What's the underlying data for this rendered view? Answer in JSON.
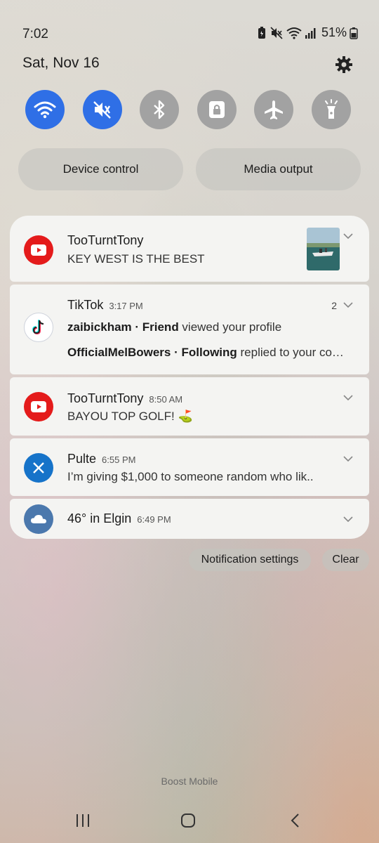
{
  "status_bar": {
    "time": "7:02",
    "battery_percent": "51%"
  },
  "header": {
    "date": "Sat, Nov 16"
  },
  "quick_toggles": [
    {
      "name": "wifi",
      "icon": "wifi-icon",
      "state": "on"
    },
    {
      "name": "sound",
      "icon": "vibrate-icon",
      "state": "on"
    },
    {
      "name": "bluetooth",
      "icon": "bluetooth-icon",
      "state": "off"
    },
    {
      "name": "rotation-lock",
      "icon": "lock-icon",
      "state": "off"
    },
    {
      "name": "airplane-mode",
      "icon": "airplane-icon",
      "state": "off"
    },
    {
      "name": "flashlight",
      "icon": "flashlight-icon",
      "state": "off"
    }
  ],
  "pills": {
    "device_control": "Device control",
    "media_output": "Media output"
  },
  "notifications": {
    "youtube1": {
      "icon": "youtube-icon",
      "title": "TooTurntTony",
      "body": "KEY WEST IS THE BEST"
    },
    "tiktok": {
      "icon": "tiktok-icon",
      "title": "TikTok",
      "time": "3:17 PM",
      "count": "2",
      "line1_name": "zaibickham · Friend",
      "line1_text": " viewed your profile",
      "line2_name": "OfficialMelBowers · Following",
      "line2_text": " replied to your co…"
    },
    "youtube2": {
      "icon": "youtube-icon",
      "title": "TooTurntTony",
      "time": "8:50 AM",
      "body": "BAYOU TOP GOLF! ⛳"
    },
    "x": {
      "icon": "x-logo-icon",
      "title": "Pulte",
      "time": "6:55 PM",
      "body": "I’m giving $1,000 to someone random who lik.."
    },
    "weather": {
      "icon": "cloud-icon",
      "title": "46° in Elgin",
      "time": "6:49 PM"
    }
  },
  "actions": {
    "settings": "Notification settings",
    "clear": "Clear"
  },
  "carrier": "Boost Mobile",
  "colors": {
    "toggle_on": "#2f6fe6",
    "toggle_off": "#a2a2a2",
    "youtube_red": "#e41b1b",
    "x_blue": "#1673c9",
    "weather_blue": "#4b78ad"
  }
}
